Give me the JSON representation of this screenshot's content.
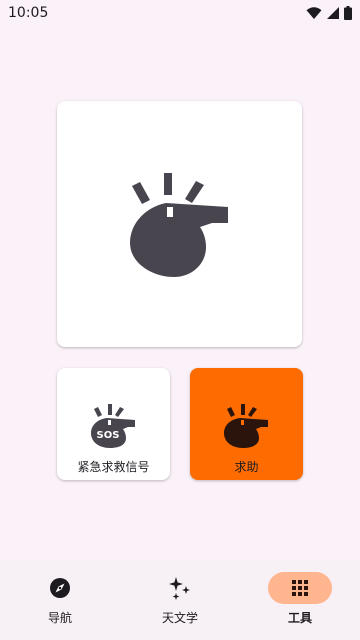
{
  "status_bar": {
    "time": "10:05",
    "icons": [
      "wifi-icon",
      "cellular-signal-icon",
      "battery-icon"
    ]
  },
  "main_card": {
    "icon": "whistle-icon"
  },
  "tools": [
    {
      "label": "紧急求救信号",
      "icon": "sos-whistle-icon",
      "sos_text": "SOS"
    },
    {
      "label": "求助",
      "icon": "whistle-icon",
      "background": "#fe6b00"
    }
  ],
  "bottom_nav": {
    "items": [
      {
        "label": "导航",
        "icon": "compass-icon",
        "active": false
      },
      {
        "label": "天文学",
        "icon": "sparkle-icon",
        "active": false
      },
      {
        "label": "工具",
        "icon": "grid-icon",
        "active": true
      }
    ]
  },
  "colors": {
    "background": "#fbf1f8",
    "accent": "#fe6b00",
    "nav_active_pill": "#ffb58e",
    "icon_dark": "#49454f"
  }
}
